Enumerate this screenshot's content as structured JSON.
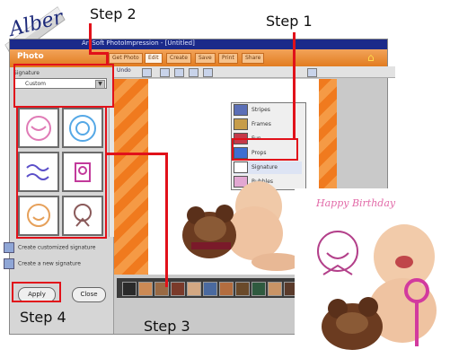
{
  "logo": {
    "text": "Alber"
  },
  "window": {
    "title": "ArcSoft PhotoImpression - [Untitled]",
    "brand": "Photo",
    "tabs": [
      "Get Photo",
      "Edit",
      "Create",
      "Save",
      "Print",
      "Share"
    ],
    "undo": "Undo"
  },
  "left_panel": {
    "signature_label": "Signature",
    "signature_select": "Custom",
    "options": [
      "Create customized signature",
      "Create a new signature"
    ],
    "apply_button": "Apply",
    "close_button": "Close"
  },
  "menu": {
    "items": [
      "Stripes",
      "Frames",
      "Fun",
      "Props",
      "Signature",
      "Bubbles"
    ],
    "selected": "Signature"
  },
  "result": {
    "caption": "Happy Birthday"
  },
  "annotations": {
    "step1": "Step 1",
    "step2": "Step 2",
    "step3": "Step 3",
    "step4": "Step 4"
  },
  "colors": {
    "annotation_red": "#e1111a",
    "title_blue": "#1b2a8a",
    "accent_orange": "#f07a1e",
    "caption_pink": "#e26aa8"
  }
}
